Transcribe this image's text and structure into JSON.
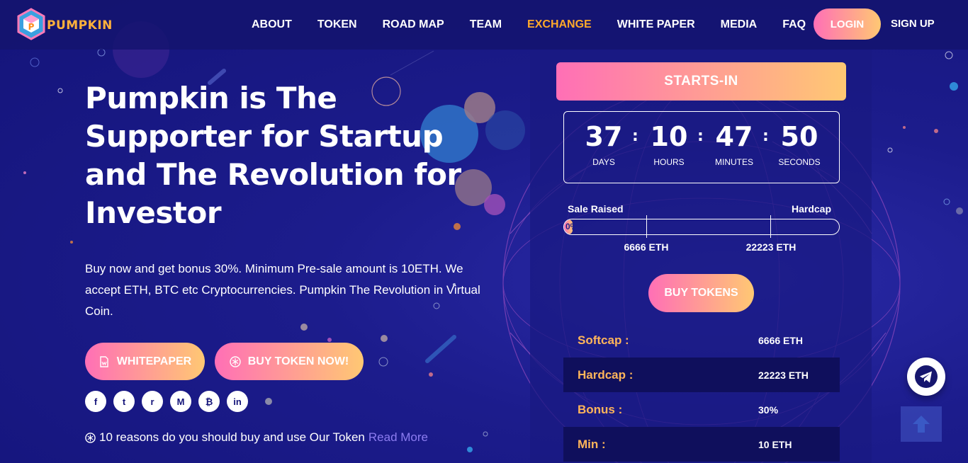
{
  "brand": {
    "name": "PUMPKIN"
  },
  "nav": {
    "items": [
      {
        "label": "ABOUT",
        "active": false
      },
      {
        "label": "TOKEN",
        "active": false
      },
      {
        "label": "ROAD MAP",
        "active": false
      },
      {
        "label": "TEAM",
        "active": false
      },
      {
        "label": "EXCHANGE",
        "active": true
      },
      {
        "label": "WHITE PAPER",
        "active": false
      },
      {
        "label": "MEDIA",
        "active": false
      },
      {
        "label": "FAQ",
        "active": false
      }
    ],
    "login": "LOGIN",
    "signup": "SIGN UP"
  },
  "hero": {
    "title": "Pumpkin is The Supporter for Startup and The Revolution for Investor",
    "description": "Buy now and get bonus 30%. Minimum Pre-sale amount is 10ETH. We accept ETH, BTC etc Cryptocurrencies. Pumpkin The Revolution in Virtual Coin.",
    "whitepaper_btn": "WHITEPAPER",
    "buy_now_btn": "BUY TOKEN NOW!",
    "socials": [
      {
        "icon": "facebook-icon",
        "glyph": "f"
      },
      {
        "icon": "twitter-icon",
        "glyph": "t"
      },
      {
        "icon": "reddit-icon",
        "glyph": "r"
      },
      {
        "icon": "medium-icon",
        "glyph": "M"
      },
      {
        "icon": "bitcoin-icon",
        "glyph": "₿"
      },
      {
        "icon": "linkedin-icon",
        "glyph": "in"
      }
    ],
    "reasons_text": "10 reasons do you should buy and use Our Token",
    "reasons_link": "Read More"
  },
  "sale": {
    "starts_in": "STARTS-IN",
    "countdown": {
      "days": "37",
      "days_label": "DAYS",
      "hours": "10",
      "hours_label": "HOURS",
      "minutes": "47",
      "minutes_label": "MINUTES",
      "seconds": "50",
      "seconds_label": "SECONDS"
    },
    "sale_raised_label": "Sale Raised",
    "hardcap_label": "Hardcap",
    "progress_percent": 0,
    "progress_text": "0%",
    "softcap_marker": "6666 ETH",
    "hardcap_marker": "22223 ETH",
    "buy_tokens_btn": "BUY TOKENS",
    "info": [
      {
        "key": "Softcap :",
        "value": "6666 ETH"
      },
      {
        "key": "Hardcap :",
        "value": "22223 ETH"
      },
      {
        "key": "Bonus :",
        "value": "30%"
      },
      {
        "key": "Min :",
        "value": "10 ETH"
      }
    ]
  },
  "colors": {
    "accent_orange": "#ffa92a",
    "gradient_start": "#ff6fb6",
    "gradient_end": "#ffc873",
    "background": "#1c1c8c"
  }
}
